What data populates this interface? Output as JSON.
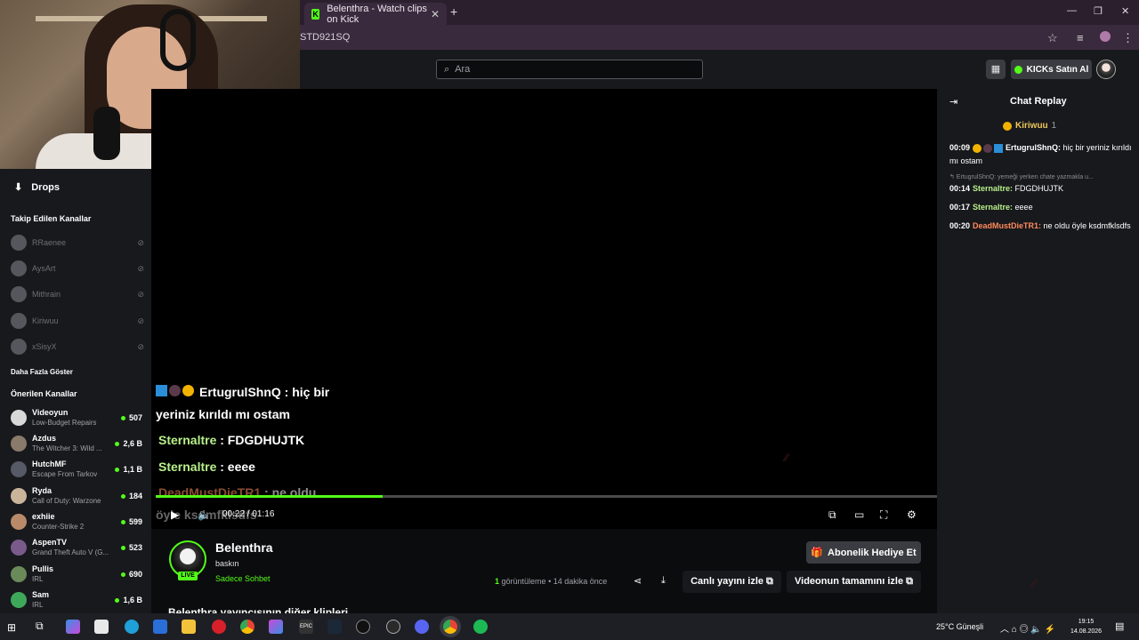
{
  "browser": {
    "tab_title": "Belenthra - Watch clips on Kick",
    "tab_close": "✕",
    "new_tab": "+",
    "url_fragment": "STD921SQ",
    "win_min": "—",
    "win_max": "❐",
    "win_close": "✕"
  },
  "header": {
    "search_placeholder": "Ara",
    "buy_kicks_label": "KICKs Satın Al"
  },
  "sidebar": {
    "drops_label": "Drops",
    "followed_title": "Takip Edilen Kanallar",
    "followed": [
      {
        "name": "RRaenee"
      },
      {
        "name": "AysArt"
      },
      {
        "name": "Mithrain"
      },
      {
        "name": "Kiriwuu"
      },
      {
        "name": "xSisyX"
      }
    ],
    "show_more": "Daha Fazla Göster",
    "recommended_title": "Önerilen Kanallar",
    "recommended": [
      {
        "name": "Videoyun",
        "game": "Low-Budget Repairs",
        "viewers": "507",
        "color": "#d8d8d8"
      },
      {
        "name": "Azdus",
        "game": "The Witcher 3: Wild ...",
        "viewers": "2,6 B",
        "color": "#8a7a6a"
      },
      {
        "name": "HutchMF",
        "game": "Escape From Tarkov",
        "viewers": "1,1 B",
        "color": "#555a66"
      },
      {
        "name": "Ryda",
        "game": "Call of Duty: Warzone",
        "viewers": "184",
        "color": "#c9b49a"
      },
      {
        "name": "exhiie",
        "game": "Counter-Strike 2",
        "viewers": "599",
        "color": "#b88a6a"
      },
      {
        "name": "AspenTV",
        "game": "Grand Theft Auto V (G...",
        "viewers": "523",
        "color": "#7a5a8a"
      },
      {
        "name": "Pullis",
        "game": "IRL",
        "viewers": "690",
        "color": "#6a8a5a"
      },
      {
        "name": "Sam",
        "game": "IRL",
        "viewers": "1,6 B",
        "color": "#3ea85a"
      }
    ]
  },
  "player": {
    "overlay": {
      "line1_user": "ErtugrulShnQ",
      "line1_msg": " : hiç bir",
      "line1b": "yeriniz kırıldı mı ostam",
      "line2_user": "Sternaltre",
      "line2_msg": " : FDGDHUJTK",
      "line3_user": "Sternaltre",
      "line3_msg": " : eeee",
      "line4_user": "DeadMustDieTR1",
      "line4_msg": " : ne oldu",
      "line4b": "öyle ksdmfklsdfs"
    },
    "time": "00:22 / 01:16",
    "progress_fraction": 0.29
  },
  "channel": {
    "name": "Belenthra",
    "title": "baskın",
    "category": "Sadece Sohbet",
    "live_label": "LIVE",
    "gift_sub_label": "Abonelik Hediye Et",
    "views_count": "1",
    "views_word": " görüntüleme",
    "time_ago": " • 14 dakika önce",
    "watch_live_label": "Canlı yayını izle ⧉",
    "watch_full_label": "Videonun tamamını izle ⧉",
    "other_clips": "Belenthra yayıncısının diğer klipleri"
  },
  "chat": {
    "title": "Chat Replay",
    "pinned_user": "Kiriwuu",
    "pinned_count": "1",
    "messages": [
      {
        "time": "00:09",
        "user": "ErtugrulShnQ:",
        "text": " hiç bir yeriniz kırıldı mı ostam"
      },
      {
        "time": "00:14",
        "user": "Sternaltre:",
        "text": " FDGDHUJTK"
      },
      {
        "time": "00:17",
        "user": "Sternaltre:",
        "text": " eeee"
      },
      {
        "time": "00:20",
        "user": "DeadMustDieTR1:",
        "text": " ne oldu öyle ksdmfklsdfs"
      }
    ],
    "reply_preview": "↰ ErtugrulShnQ: yemeği yerken chate yazmakla u..."
  },
  "taskbar": {
    "weather": "25°C  Güneşli",
    "time": "19:15",
    "date": "14.08.2026"
  }
}
